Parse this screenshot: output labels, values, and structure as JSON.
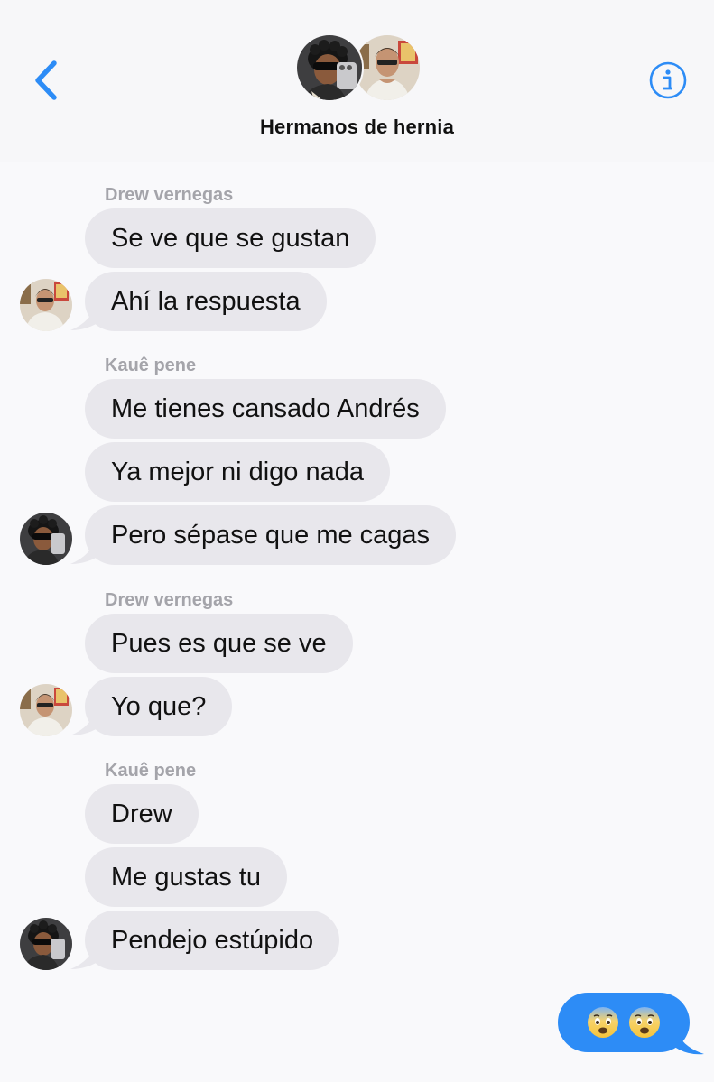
{
  "header": {
    "title": "Hermanos de hernia",
    "back_icon": "chevron-left-icon",
    "info_icon": "info-circle-icon"
  },
  "colors": {
    "accent": "#2d8cf6",
    "incoming_bubble": "#e8e7ec",
    "sender_label": "#a4a4aa",
    "background": "#f9f9fb"
  },
  "messages": {
    "g1": {
      "sender": "Drew vernegas",
      "m1": "Se ve que se gustan",
      "m2": "Ahí la respuesta"
    },
    "g2": {
      "sender": "Kauê pene",
      "m1": "Me tienes cansado Andrés",
      "m2": "Ya mejor ni digo nada",
      "m3": "Pero sépase que me cagas"
    },
    "g3": {
      "sender": "Drew vernegas",
      "m1": "Pues es que se ve",
      "m2": "Yo que?"
    },
    "g4": {
      "sender": "Kauê pene",
      "m1": "Drew",
      "m2": "Me gustas tu",
      "m3": "Pendejo estúpido"
    },
    "outgoing": {
      "content": "fearful-face-emoji fearful-face-emoji"
    }
  }
}
